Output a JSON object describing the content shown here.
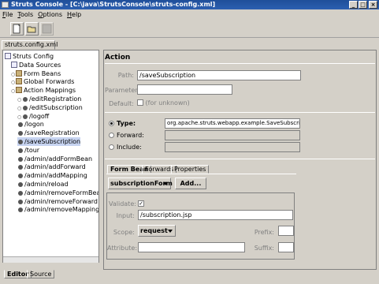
{
  "window": {
    "title": "Struts Console - [C:\\java\\StrutsConsole\\struts-config.xml]"
  },
  "menu": [
    "File",
    "Tools",
    "Options",
    "Help"
  ],
  "toolbar": {
    "icons": [
      "new-file-icon",
      "open-icon",
      "save-icon"
    ]
  },
  "file_tab": "struts.config.xml [1.0]",
  "tree": {
    "items": [
      {
        "label": "Struts Config",
        "level": 0,
        "icon": "doc"
      },
      {
        "label": "Data Sources",
        "level": 1,
        "icon": "doc"
      },
      {
        "label": "Form Beans",
        "level": 1,
        "icon": "folder"
      },
      {
        "label": "Global Forwards",
        "level": 1,
        "icon": "folder"
      },
      {
        "label": "Action Mappings",
        "level": 1,
        "icon": "folder"
      },
      {
        "label": "/editRegistration",
        "level": 2,
        "icon": "gear"
      },
      {
        "label": "/editSubscription",
        "level": 2,
        "icon": "gear"
      },
      {
        "label": "/logoff",
        "level": 2,
        "icon": "gear"
      },
      {
        "label": "/logon",
        "level": 2,
        "icon": "gear"
      },
      {
        "label": "/saveRegistration",
        "level": 2,
        "icon": "gear"
      },
      {
        "label": "/saveSubscription",
        "level": 2,
        "icon": "gear",
        "selected": true
      },
      {
        "label": "/tour",
        "level": 2,
        "icon": "gear"
      },
      {
        "label": "/admin/addFormBean",
        "level": 2,
        "icon": "gear"
      },
      {
        "label": "/admin/addForward",
        "level": 2,
        "icon": "gear"
      },
      {
        "label": "/admin/addMapping",
        "level": 2,
        "icon": "gear"
      },
      {
        "label": "/admin/reload",
        "level": 2,
        "icon": "gear"
      },
      {
        "label": "/admin/removeFormBean",
        "level": 2,
        "icon": "gear"
      },
      {
        "label": "/admin/removeForward",
        "level": 2,
        "icon": "gear"
      },
      {
        "label": "/admin/removeMapping",
        "level": 2,
        "icon": "gear"
      }
    ]
  },
  "action": {
    "title": "Action",
    "path_label": "Path:",
    "path_value": "/saveSubscription",
    "parameter_label": "Parameter:",
    "parameter_value": "",
    "default_label": "Default:",
    "default_text": "(for unknown)",
    "type_label": "Type:",
    "type_value": "org.apache.struts.webapp.example.SaveSubscriptionAction",
    "forward_label": "Forward:",
    "include_label": "Include:"
  },
  "subtabs": [
    "Form Bean",
    "Forwards",
    "Properties"
  ],
  "formbean": {
    "name_value": "subscriptionForm",
    "add_button": "Add...",
    "validate_label": "Validate:",
    "input_label": "Input:",
    "input_value": "/subscription.jsp",
    "scope_label": "Scope:",
    "scope_value": "request",
    "prefix_label": "Prefix:",
    "attribute_label": "Attribute:",
    "suffix_label": "Suffix:"
  },
  "bottom_tabs": [
    "Editor",
    "Source"
  ]
}
